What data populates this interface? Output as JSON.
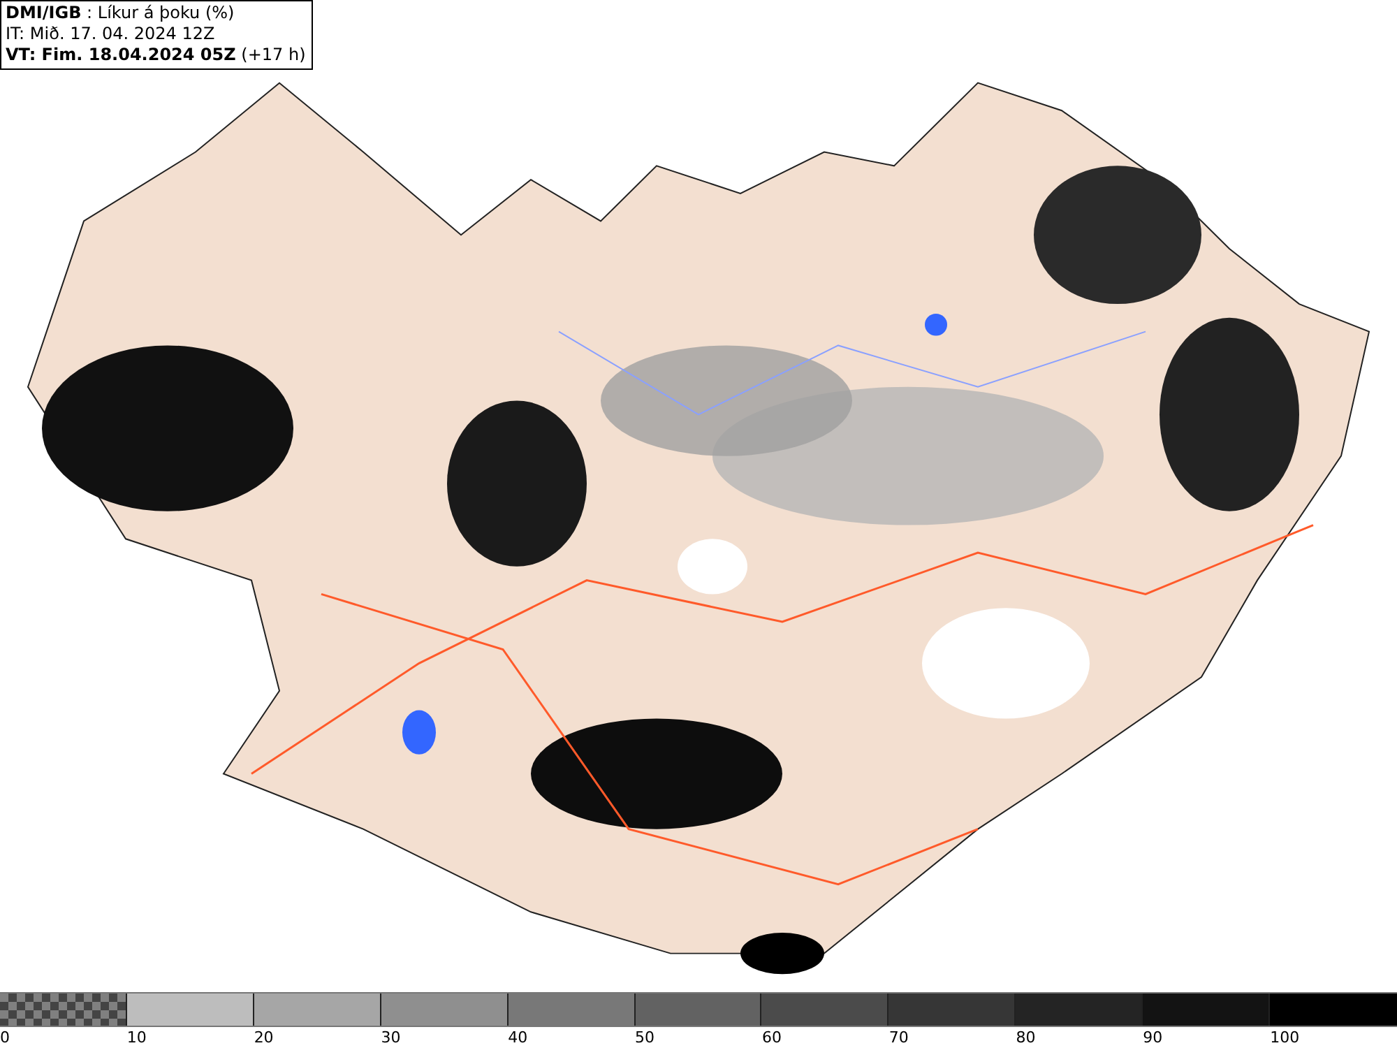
{
  "title_box": {
    "lines": [
      "**DMI/IGB** : Líkur á þoku (%)",
      "IT: Mið. 17. 04. 2024 12Z",
      "**VT: Fim. 18.04.2024 05Z** (+17 h)"
    ]
  },
  "legend": {
    "segments": [
      {
        "kind": "checker",
        "color": "#808080"
      },
      {
        "kind": "solid",
        "color": "#bdbdbd"
      },
      {
        "kind": "solid",
        "color": "#a6a6a6"
      },
      {
        "kind": "solid",
        "color": "#8f8f8f"
      },
      {
        "kind": "solid",
        "color": "#787878"
      },
      {
        "kind": "solid",
        "color": "#626262"
      },
      {
        "kind": "solid",
        "color": "#4b4b4b"
      },
      {
        "kind": "solid",
        "color": "#363636"
      },
      {
        "kind": "solid",
        "color": "#242424"
      },
      {
        "kind": "solid",
        "color": "#131313"
      },
      {
        "kind": "solid",
        "color": "#000000"
      }
    ],
    "labels": [
      "0",
      "10",
      "20",
      "30",
      "40",
      "50",
      "60",
      "70",
      "80",
      "90",
      "100"
    ]
  }
}
